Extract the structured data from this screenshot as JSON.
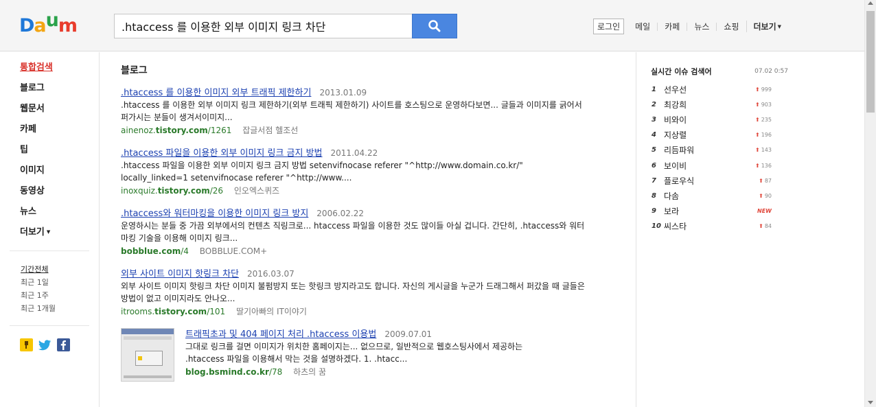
{
  "header": {
    "logo": [
      "D",
      "a",
      "u",
      "m"
    ],
    "logo_colors": [
      "#1f78d8",
      "#f3a512",
      "#2aa24a",
      "#e83c2c"
    ],
    "search_value": ".htaccess 를 이용한 외부 이미지 링크 차단",
    "login_label": "로그인",
    "nav": [
      "메일",
      "카페",
      "뉴스",
      "쇼핑"
    ],
    "more_label": "더보기"
  },
  "sidebar": {
    "items": [
      "통합검색",
      "블로그",
      "웹문서",
      "카페",
      "팁",
      "이미지",
      "동영상",
      "뉴스",
      "더보기"
    ],
    "period": [
      "기간전체",
      "최근 1일",
      "최근 1주",
      "최근 1개월"
    ]
  },
  "main": {
    "section_title": "블로그",
    "results": [
      {
        "title": ".htaccess 를 이용한 이미지 외부 트래픽 제한하기",
        "date": "2013.01.09",
        "desc": ".htaccess 를 이용한 외부 이미지 링크 제한하기(외부 트래픽 제한하기) 사이트를 호스팅으로 운영하다보면... 글들과 이미지를 긁어서 퍼가시는 분들이 생겨서이미지...",
        "url_host": "ainenoz.",
        "url_domain": "tistory.com",
        "url_path": "/1261",
        "source": "잡글서점 헬조선"
      },
      {
        "title": ".htaccess 파일을 이용한 외부 이미지 링크 금지 방법",
        "date": "2011.04.22",
        "desc": ".htaccess 파일을 이용한 외부 이미지 링크 금지 방법 setenvifnocase referer \"^http://www.domain.co.kr/\" locally_linked=1 setenvifnocase referer \"^http://www....",
        "url_host": "inoxquiz.",
        "url_domain": "tistory.com",
        "url_path": "/26",
        "source": "인오엑스퀴즈"
      },
      {
        "title": ".htaccess와 워터마킹을 이용한 이미지 링크 방지",
        "date": "2006.02.22",
        "desc": "운영하시는 분들 중 가끔 외부에서의 컨텐츠 직링크로... htaccess 파일을 이용한 것도 많이들 아실 겁니다. 간단히, .htaccess와 워터마킹 기술을 이용해 이미지 링크...",
        "url_host": "",
        "url_domain": "bobblue.com",
        "url_path": "/4",
        "source": "BOBBLUE.COM+"
      },
      {
        "title": "외부 사이트 이미지 핫링크 차단",
        "date": "2016.03.07",
        "desc": "외부 사이트 이미지 핫링크 차단 이미지 불펌방지 또는 핫링크 방지라고도 합니다. 자신의 게시글을 누군가 드래그해서 퍼갔을 때 글들은 방법이 없고 이미지라도 안나오...",
        "url_host": "itrooms.",
        "url_domain": "tistory.com",
        "url_path": "/101",
        "source": "딸기아빠의 IT이야기"
      },
      {
        "title": "트래픽초과 및 404 페이지 처리 .htaccess 이용법",
        "date": "2009.07.01",
        "desc": "그대로 링크를 걸면 이미지가 위치한 홈페이지는... 없으므로, 일반적으로 웹호스팅사에서 제공하는 .htaccess 파일을 이용해서 막는 것을 설명하겠다. 1. .htacc...",
        "url_host": "",
        "url_domain": "blog.bsmind.co.kr",
        "url_path": "/78",
        "source": "하츠의 꿈"
      }
    ]
  },
  "realtime": {
    "title": "실시간 이슈 검색어",
    "time": "07.02  0:57",
    "items": [
      {
        "rank": "1",
        "word": "선우선",
        "change": "999"
      },
      {
        "rank": "2",
        "word": "최강희",
        "change": "903"
      },
      {
        "rank": "3",
        "word": "비와이",
        "change": "235"
      },
      {
        "rank": "4",
        "word": "지상렬",
        "change": "196"
      },
      {
        "rank": "5",
        "word": "리듬파워",
        "change": "143"
      },
      {
        "rank": "6",
        "word": "보이비",
        "change": "136"
      },
      {
        "rank": "7",
        "word": "플로우식",
        "change": "87"
      },
      {
        "rank": "8",
        "word": "다솜",
        "change": "90"
      },
      {
        "rank": "9",
        "word": "보라",
        "change": "NEW"
      },
      {
        "rank": "10",
        "word": "씨스타",
        "change": "84"
      }
    ]
  }
}
